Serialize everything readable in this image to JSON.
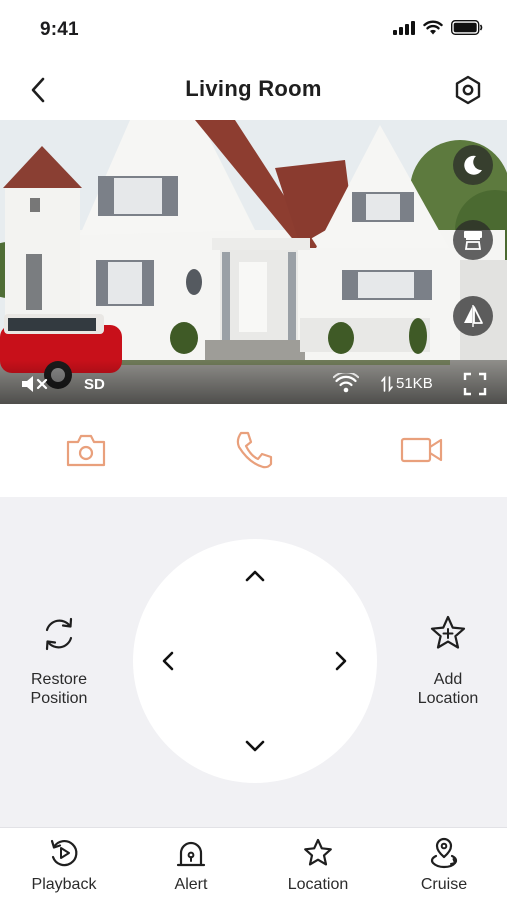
{
  "status_bar": {
    "time": "9:41"
  },
  "nav": {
    "title": "Living Room"
  },
  "video": {
    "quality": "SD",
    "bitrate": "51KB",
    "side_controls": [
      "moon-icon",
      "privacy-shield-icon",
      "flip-icon"
    ]
  },
  "actions": {
    "snapshot": "camera-icon",
    "talk": "phone-icon",
    "record": "video-icon",
    "accent_color": "#e9a07c"
  },
  "control_panel": {
    "restore_label": "Restore\nPosition",
    "add_location_label": "Add\nLocation"
  },
  "tab_bar": {
    "items": [
      {
        "label": "Playback",
        "icon": "playback-icon"
      },
      {
        "label": "Alert",
        "icon": "alert-icon"
      },
      {
        "label": "Location",
        "icon": "star-icon"
      },
      {
        "label": "Cruise",
        "icon": "cruise-icon"
      }
    ]
  }
}
